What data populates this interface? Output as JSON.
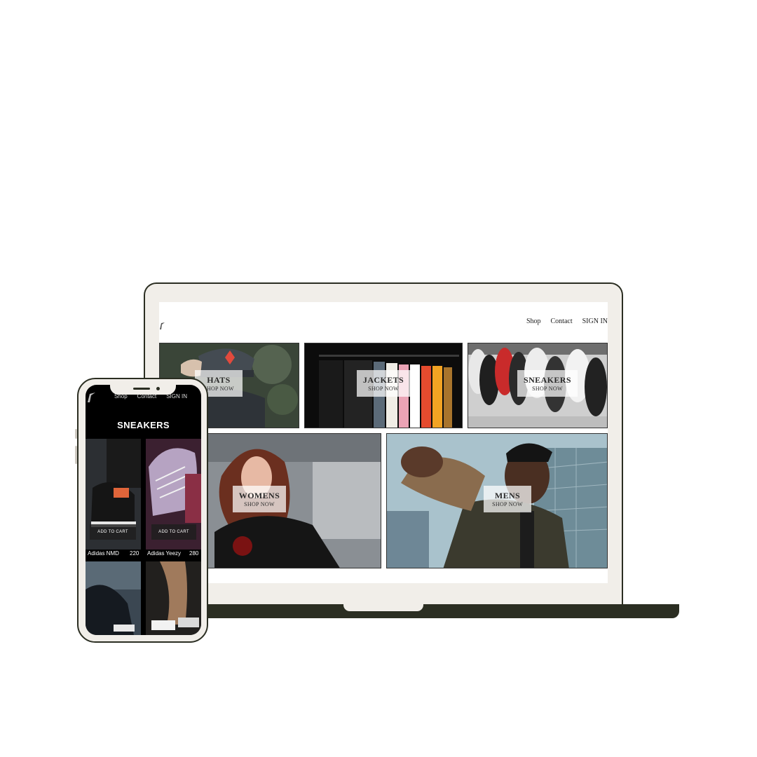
{
  "laptop": {
    "nav": [
      "Shop",
      "Contact",
      "SIGN IN"
    ],
    "tiles": [
      {
        "title": "HATS",
        "subtitle": "SHOP NOW"
      },
      {
        "title": "JACKETS",
        "subtitle": "SHOP NOW"
      },
      {
        "title": "SNEAKERS",
        "subtitle": "SHOP NOW"
      },
      {
        "title": "WOMENS",
        "subtitle": "SHOP NOW"
      },
      {
        "title": "MENS",
        "subtitle": "SHOP NOW"
      }
    ]
  },
  "phone": {
    "nav": [
      "Shop",
      "Contact",
      "SIGN IN"
    ],
    "page_title": "SNEAKERS",
    "products": [
      {
        "name": "Adidas NMD",
        "price": "220",
        "button": "ADD TO CART"
      },
      {
        "name": "Adidas Yeezy",
        "price": "280",
        "button": "ADD TO CART"
      }
    ]
  },
  "colors": {
    "frame": "#2b2e22",
    "bezel": "#f1eee9",
    "overlay": "#ffffff"
  }
}
